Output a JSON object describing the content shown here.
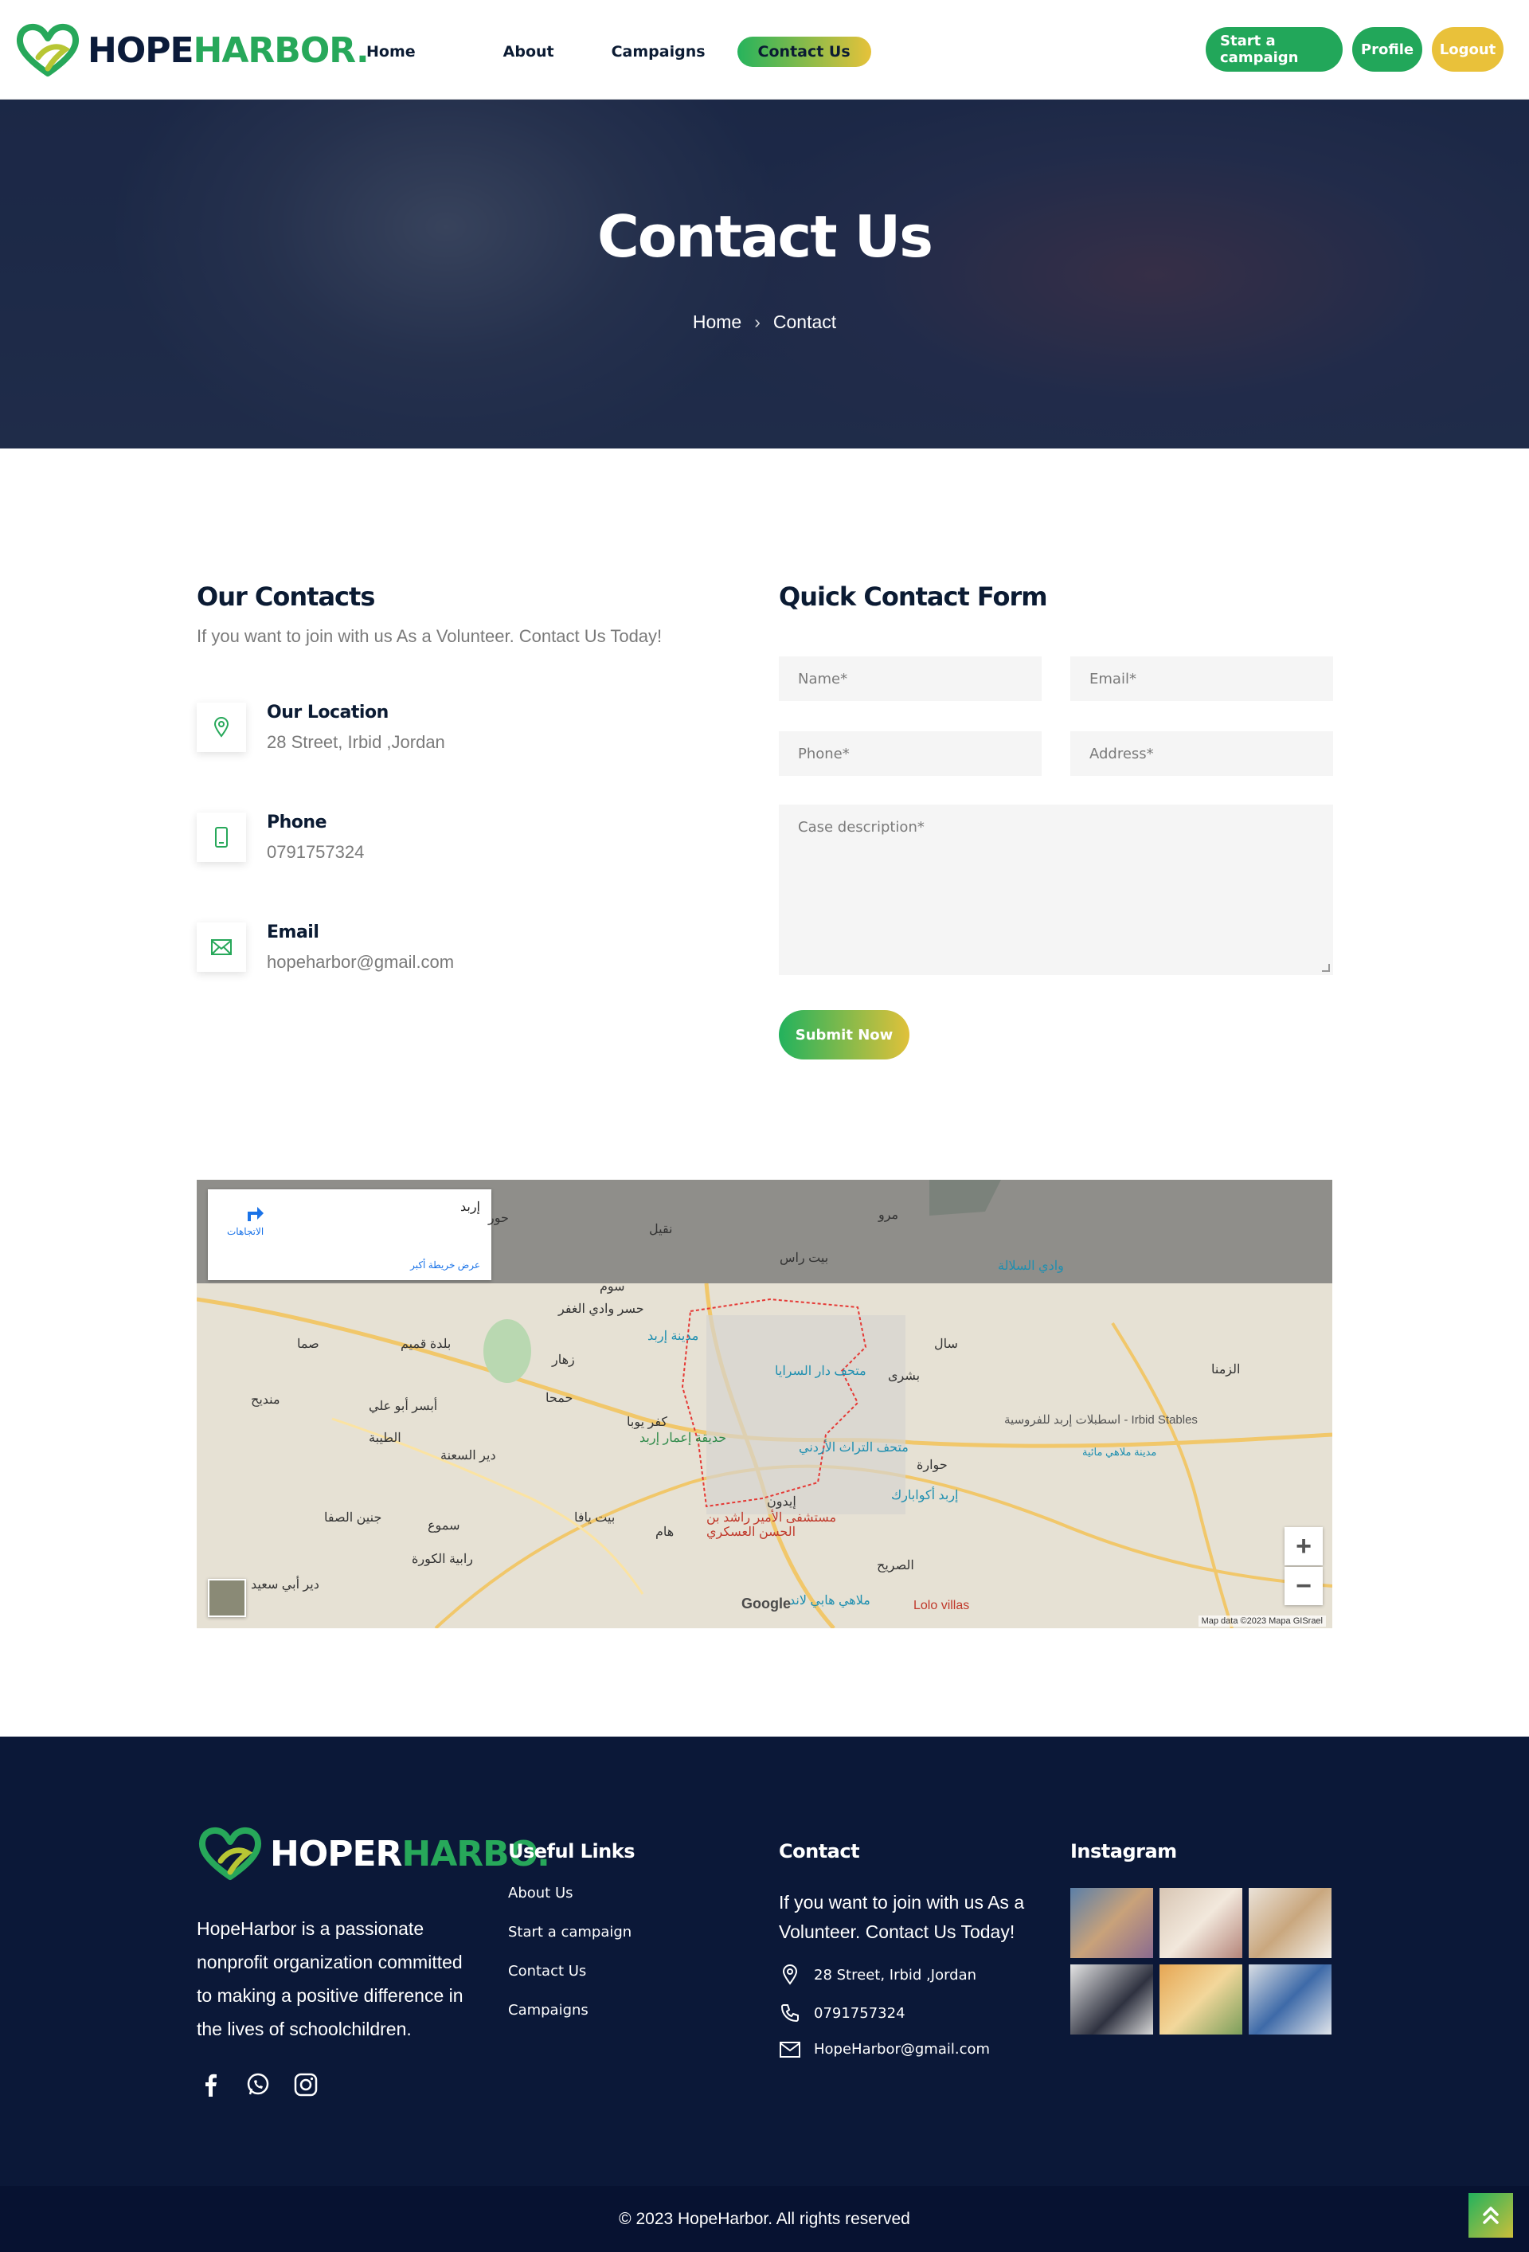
{
  "brand": {
    "name_a": "HOPE",
    "name_b": "HARBOR."
  },
  "nav": {
    "links": [
      "Home",
      "About",
      "Campaigns",
      "Contact Us"
    ],
    "buttons": [
      "Start a campaign",
      "Profile",
      "Logout"
    ]
  },
  "hero": {
    "title": "Contact Us",
    "crumb_home": "Home",
    "crumb_sep": "›",
    "crumb_current": "Contact"
  },
  "contacts": {
    "title": "Our Contacts",
    "subtitle": "If you want to join with us As a Volunteer. Contact Us Today!",
    "items": [
      {
        "label": "Our Location",
        "value": "28 Street, Irbid ,Jordan",
        "icon": "location-pin-icon"
      },
      {
        "label": "Phone",
        "value": "0791757324",
        "icon": "phone-icon"
      },
      {
        "label": "Email",
        "value": "hopeharbor@gmail.com",
        "icon": "mail-icon"
      }
    ]
  },
  "form": {
    "title": "Quick Contact Form",
    "name_placeholder": "Name*",
    "email_placeholder": "Email*",
    "phone_placeholder": "Phone*",
    "address_placeholder": "Address*",
    "desc_placeholder": "Case description*",
    "submit_label": "Submit Now"
  },
  "map": {
    "card_place": "إربد",
    "card_directions": "الاتجاهات",
    "card_bigger": "عرض خريطة أكبر",
    "labels": [
      "حور",
      "نقيل",
      "مرو",
      "بيت راس",
      "وادي السلالة",
      "سوم",
      "حسر وادي الغفر",
      "مدينة إربد",
      "صما",
      "بلدة قميم",
      "زهار",
      "حمحا",
      "سال",
      "متحف دار السرايا",
      "بشرى",
      "الزمنا",
      "منديح",
      "أبسر أبو علي",
      "كفر يوبا",
      "حديقة إعمار إربد",
      "الطيبة",
      "دير السعنة",
      "متحف التراث الأردني",
      "حوارة",
      "اسطبلات إربد للفروسية - Irbid Stables",
      "مدينة ملاهي مائية",
      "إربد أكوابارك",
      "إيدون",
      "جنين الصفا",
      "سموع",
      "بيت يافا",
      "هام",
      "مستشفى الأمير راشد بن الحسن العسكري",
      "رابية الكورة",
      "الصريح",
      "دير أبي سعيد",
      "ملاهي هابي لاند",
      "Lolo villas"
    ],
    "google": "Google",
    "credit": "Map data ©2023 Mapa GISrael",
    "zoom_in": "+",
    "zoom_out": "−"
  },
  "footer": {
    "brand_a": "HOPER",
    "brand_b": "HARBO.",
    "about": "HopeHarbor is a passionate nonprofit organization committed to making a positive difference in the lives of schoolchildren.",
    "links_title": "Useful Links",
    "links": [
      "About Us",
      "Start a campaign",
      "Contact Us",
      "Campaigns"
    ],
    "contact_title": "Contact",
    "contact_sub": "If you want to join with us As a Volunteer. Contact Us Today!",
    "contact_items": [
      "28 Street, Irbid ,Jordan",
      "0791757324",
      "HopeHarbor@gmail.com"
    ],
    "instagram_title": "Instagram",
    "copyright": "© 2023 HopeHarbor. All rights reserved"
  },
  "colors": {
    "green": "#22a75a",
    "yellow": "#e9c13a",
    "navy": "#0b1838"
  }
}
